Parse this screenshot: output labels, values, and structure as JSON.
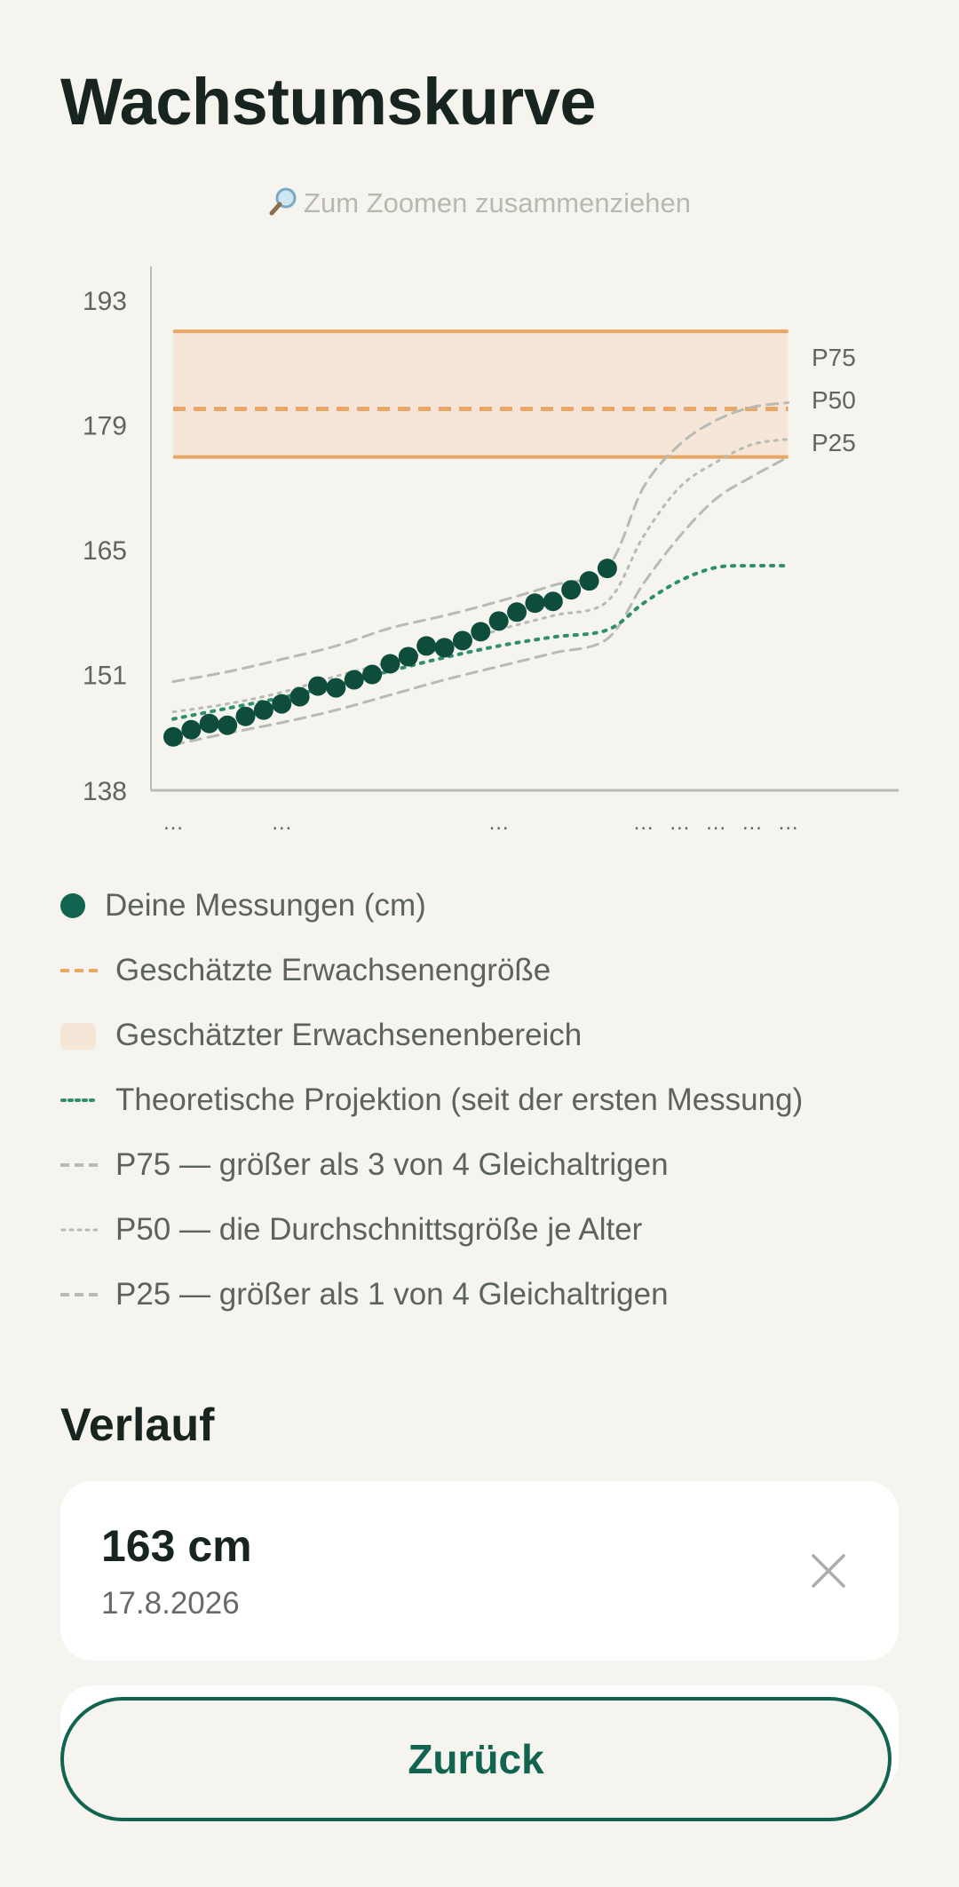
{
  "page": {
    "title": "Wachstumskurve",
    "zoom_hint": "Zum Zoomen zusammenziehen",
    "zoom_icon": "magnifier-icon"
  },
  "colors": {
    "background": "#f5f4ef",
    "measurement": "#0e4d3c",
    "adult_estimate": "#e8a766",
    "adult_range": "#f6e6d8",
    "projection": "#2f8e6c",
    "percentile": "#b8bab5",
    "accent": "#11644f"
  },
  "chart_data": {
    "type": "line",
    "y_ticks": [
      "193",
      "179",
      "165",
      "151",
      "138"
    ],
    "ylim": [
      138,
      194
    ],
    "x_tick_labels": [
      "…",
      "…",
      "…",
      "…",
      "…",
      "…",
      "…",
      "…"
    ],
    "x_tick_positions": [
      0,
      3,
      9,
      13,
      14,
      15,
      16,
      17
    ],
    "xlim": [
      0,
      17.5
    ],
    "adult_range": [
      175.4,
      189.5
    ],
    "adult_estimate": 180.8,
    "measurements": [
      [
        0,
        144.0
      ],
      [
        0.5,
        144.8
      ],
      [
        1,
        145.5
      ],
      [
        1.5,
        145.3
      ],
      [
        2,
        146.3
      ],
      [
        2.5,
        147.0
      ],
      [
        3,
        147.7
      ],
      [
        3.5,
        148.5
      ],
      [
        4,
        149.7
      ],
      [
        4.5,
        149.5
      ],
      [
        5,
        150.4
      ],
      [
        5.5,
        151.0
      ],
      [
        6,
        152.2
      ],
      [
        6.5,
        153.0
      ],
      [
        7,
        154.2
      ],
      [
        7.5,
        154.0
      ],
      [
        8,
        154.8
      ],
      [
        8.5,
        155.8
      ],
      [
        9,
        157.0
      ],
      [
        9.5,
        158.0
      ],
      [
        10,
        159.0
      ],
      [
        10.5,
        159.2
      ],
      [
        11,
        160.5
      ],
      [
        11.5,
        161.5
      ],
      [
        12,
        162.9
      ]
    ],
    "series": [
      {
        "name": "P75",
        "points": [
          [
            0,
            150.2
          ],
          [
            1.5,
            151.3
          ],
          [
            3,
            152.7
          ],
          [
            4.5,
            154.2
          ],
          [
            6,
            156.2
          ],
          [
            7.5,
            157.6
          ],
          [
            9,
            159.2
          ],
          [
            10.5,
            161.0
          ],
          [
            12,
            163.0
          ],
          [
            13,
            172.0
          ],
          [
            14,
            176.8
          ],
          [
            15,
            179.5
          ],
          [
            16,
            181.0
          ],
          [
            17,
            181.5
          ]
        ]
      },
      {
        "name": "P50",
        "points": [
          [
            0,
            146.8
          ],
          [
            1.5,
            147.7
          ],
          [
            3,
            149.0
          ],
          [
            4.5,
            150.8
          ],
          [
            6,
            152.4
          ],
          [
            7.5,
            154.0
          ],
          [
            9,
            156.0
          ],
          [
            10.5,
            157.6
          ],
          [
            12,
            159.2
          ],
          [
            13,
            166.5
          ],
          [
            14,
            172.0
          ],
          [
            15,
            174.8
          ],
          [
            16,
            176.8
          ],
          [
            17,
            177.4
          ]
        ]
      },
      {
        "name": "P25",
        "points": [
          [
            0,
            143.1
          ],
          [
            1.5,
            144.4
          ],
          [
            3,
            145.6
          ],
          [
            4.5,
            147.0
          ],
          [
            6,
            148.7
          ],
          [
            7.5,
            150.4
          ],
          [
            9,
            151.9
          ],
          [
            10.5,
            153.4
          ],
          [
            12,
            155.0
          ],
          [
            13,
            161.2
          ],
          [
            14,
            166.5
          ],
          [
            15,
            170.7
          ],
          [
            16,
            173.2
          ],
          [
            17,
            175.4
          ]
        ]
      },
      {
        "name": "projection",
        "points": [
          [
            0,
            146.0
          ],
          [
            1.5,
            147.2
          ],
          [
            3,
            148.4
          ],
          [
            4.5,
            149.8
          ],
          [
            6,
            151.4
          ],
          [
            7.5,
            152.9
          ],
          [
            9,
            154.2
          ],
          [
            10.5,
            155.2
          ],
          [
            12,
            156.0
          ],
          [
            13,
            159.0
          ],
          [
            14,
            161.5
          ],
          [
            15,
            163.0
          ],
          [
            16,
            163.2
          ],
          [
            17,
            163.2
          ]
        ]
      }
    ],
    "percentile_labels": [
      "P75",
      "P50",
      "P25"
    ]
  },
  "legend": [
    {
      "label": "Deine Messungen (cm)",
      "marker": "dot"
    },
    {
      "label": "Geschätzte Erwachsenengröße",
      "marker": "dashed-orange"
    },
    {
      "label": "Geschätzter Erwachsenenbereich",
      "marker": "shaded-range"
    },
    {
      "label": "Theoretische Projektion (seit der ersten Messung)",
      "marker": "dotted-green"
    },
    {
      "label": "P75 — größer als 3 von 4 Gleichaltrigen",
      "marker": "dashed-gray"
    },
    {
      "label": "P50 — die Durchschnittsgröße je Alter",
      "marker": "dotted-gray"
    },
    {
      "label": "P25 — größer als 1 von 4 Gleichaltrigen",
      "marker": "dashed-gray"
    }
  ],
  "history": {
    "title": "Verlauf",
    "entries": [
      {
        "value": "163 cm",
        "date": "17.8.2026",
        "delete_icon": "close-icon"
      }
    ]
  },
  "back_button": "Zurück"
}
